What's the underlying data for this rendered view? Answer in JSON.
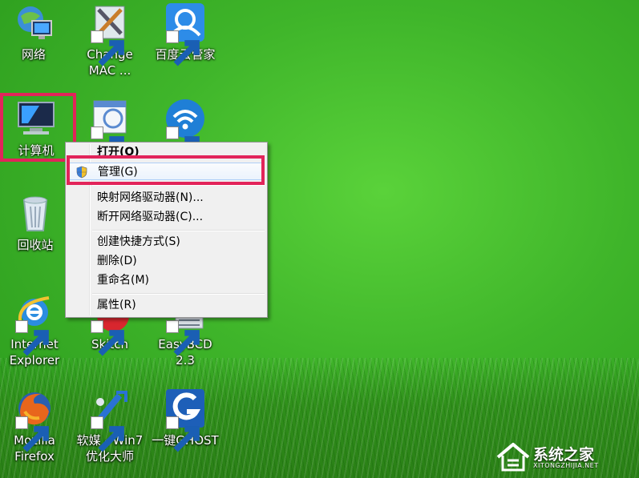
{
  "desktop": {
    "icons": [
      {
        "label": "网络"
      },
      {
        "label": "Change\nMAC ..."
      },
      {
        "label": "百度云管家"
      },
      {
        "label": "计算机"
      },
      {
        "label": "回收站"
      },
      {
        "label": "Internet\nExplorer"
      },
      {
        "label": "Skitch"
      },
      {
        "label": "EasyBCD\n2.3"
      },
      {
        "label": "Mozilla\nFirefox"
      },
      {
        "label": "软媒 - Win7\n优化大师"
      },
      {
        "label": "一键GHOST"
      }
    ]
  },
  "context_menu": {
    "items": [
      {
        "label": "打开(O)"
      },
      {
        "label": "管理(G)"
      },
      {
        "label": "映射网络驱动器(N)..."
      },
      {
        "label": "断开网络驱动器(C)..."
      },
      {
        "label": "创建快捷方式(S)"
      },
      {
        "label": "删除(D)"
      },
      {
        "label": "重命名(M)"
      },
      {
        "label": "属性(R)"
      }
    ]
  },
  "watermark": {
    "text": "系统之家",
    "subtext": "XITONGZHIJIA.NET"
  },
  "colors": {
    "highlight": "#e2245a",
    "desktop_green": "#3fb52a"
  }
}
